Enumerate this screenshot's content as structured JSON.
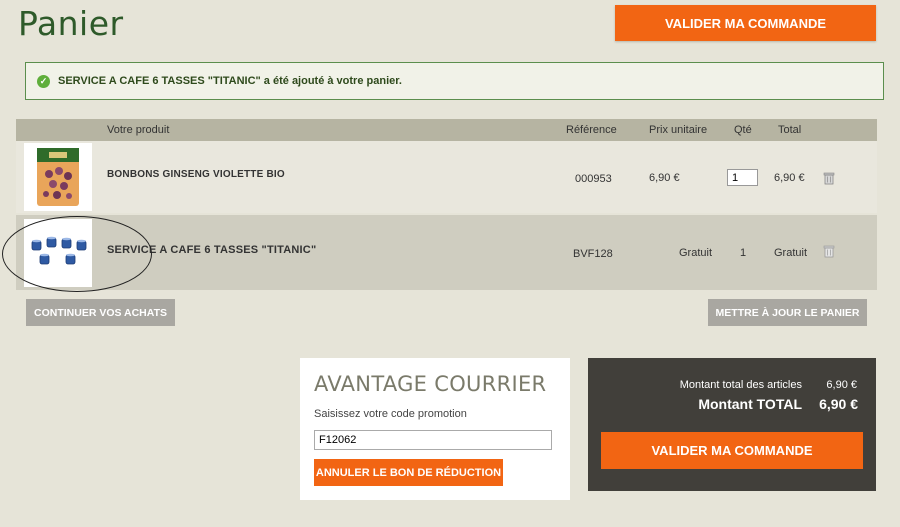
{
  "header": {
    "title": "Panier",
    "validate_label": "VALIDER MA COMMANDE"
  },
  "notice": {
    "message": "SERVICE A CAFE 6 TASSES \"TITANIC\" a été ajouté à votre panier.",
    "icon": "check-circle-icon",
    "color": "#5fae3b"
  },
  "table": {
    "columns": {
      "product": "Votre produit",
      "reference": "Référence",
      "unit_price": "Prix unitaire",
      "qty": "Qté",
      "total": "Total"
    },
    "rows": [
      {
        "name": "BONBONS GINSENG VIOLETTE BIO",
        "reference": "000953",
        "unit_price": "6,90 €",
        "qty": "1",
        "total": "6,90 €",
        "image": "ginseng-candy-bag-image"
      },
      {
        "name": "SERVICE A CAFE 6 TASSES \"TITANIC\"",
        "reference": "BVF128",
        "unit_price": "Gratuit",
        "qty": "1",
        "total": "Gratuit",
        "image": "coffee-cups-image"
      }
    ]
  },
  "actions": {
    "continue_label": "CONTINUER VOS ACHATS",
    "update_label": "METTRE À JOUR LE PANIER"
  },
  "coupon": {
    "title": "AVANTAGE COURRIER",
    "label": "Saisissez votre code promotion",
    "value": "F12062",
    "cancel_label": "ANNULER LE BON DE RÉDUCTION"
  },
  "totals": {
    "subtotal_label": "Montant total des articles",
    "subtotal_value": "6,90 €",
    "total_label": "Montant TOTAL",
    "total_value": "6,90 €",
    "validate_label": "VALIDER MA COMMANDE"
  },
  "colors": {
    "accent": "#f26513",
    "title_green": "#2e5a2a",
    "background": "#e6e4d8",
    "dark_panel": "#413f3a"
  }
}
